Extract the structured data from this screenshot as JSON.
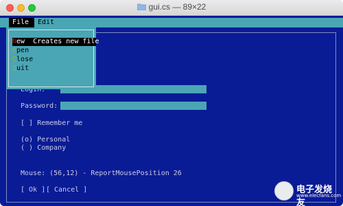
{
  "window": {
    "title": "gui.cs — 89×22"
  },
  "menubar": {
    "items": [
      "File",
      "Edit"
    ]
  },
  "file_menu": {
    "items": [
      {
        "hotkey": "N",
        "rest": "ew",
        "desc": "Creates new file"
      },
      {
        "hotkey": "O",
        "rest": "pen",
        "desc": ""
      },
      {
        "hotkey": "C",
        "rest": "lose",
        "desc": ""
      },
      {
        "hotkey": "Q",
        "rest": "uit",
        "desc": ""
      }
    ]
  },
  "form": {
    "login_label": "Login:",
    "password_label": "Password:",
    "remember_checkbox": "[ ] Remember me",
    "radio_personal": "(o) Personal",
    "radio_company": "( ) Company",
    "mouse_status": "Mouse: (56,12) - ReportMousePosition 26",
    "ok_button": "[ Ok ]",
    "cancel_button": "[ Cancel ]"
  },
  "watermark": {
    "line1": "电子发烧友",
    "line2": "www.elecfans.com"
  },
  "colors": {
    "terminal_bg": "#0a1b96",
    "accent_teal": "#4aa6b4",
    "text": "#c9cde6",
    "hotkey": "#c7a400"
  }
}
